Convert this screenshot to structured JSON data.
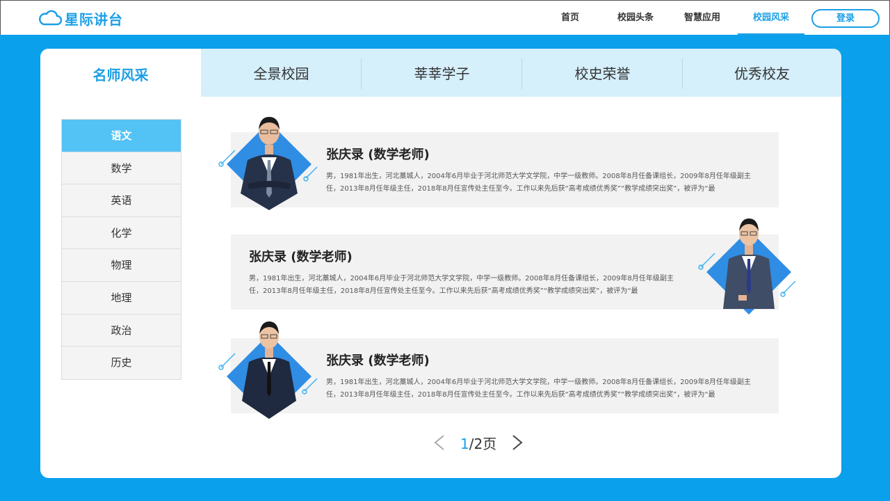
{
  "header": {
    "logo_text": "星际讲台",
    "nav": [
      {
        "label": "首页",
        "active": false
      },
      {
        "label": "校园头条",
        "active": false
      },
      {
        "label": "智慧应用",
        "active": false
      },
      {
        "label": "校园风采",
        "active": true
      }
    ],
    "login_label": "登录"
  },
  "tabs": [
    {
      "label": "名师风采",
      "active": true
    },
    {
      "label": "全景校园",
      "active": false
    },
    {
      "label": "莘莘学子",
      "active": false
    },
    {
      "label": "校史荣誉",
      "active": false
    },
    {
      "label": "优秀校友",
      "active": false
    }
  ],
  "sidebar": {
    "items": [
      {
        "label": "语文",
        "active": true
      },
      {
        "label": "数学",
        "active": false
      },
      {
        "label": "英语",
        "active": false
      },
      {
        "label": "化学",
        "active": false
      },
      {
        "label": "物理",
        "active": false
      },
      {
        "label": "地理",
        "active": false
      },
      {
        "label": "政治",
        "active": false
      },
      {
        "label": "历史",
        "active": false
      }
    ]
  },
  "teachers": [
    {
      "name": "张庆录 (数学老师)",
      "desc": "男，1981年出生，河北藁城人，2004年6月毕业于河北师范大学文学院，中学一级教师。2008年8月任备课组长，2009年8月任年级副主任，2013年8月任年级主任，2018年8月任宣传处主任至今。工作以来先后获“高考成绩优秀奖”“教学成绩突出奖”，被评为“最"
    },
    {
      "name": "张庆录 (数学老师)",
      "desc": "男，1981年出生，河北藁城人，2004年6月毕业于河北师范大学文学院，中学一级教师。2008年8月任备课组长，2009年8月任年级副主任，2013年8月任年级主任，2018年8月任宣传处主任至今。工作以来先后获“高考成绩优秀奖”“教学成绩突出奖”，被评为“最"
    },
    {
      "name": "张庆录 (数学老师)",
      "desc": "男，1981年出生，河北藁城人，2004年6月毕业于河北师范大学文学院，中学一级教师。2008年8月任备课组长，2009年8月任年级副主任，2013年8月任年级主任，2018年8月任宣传处主任至今。工作以来先后获“高考成绩优秀奖”“教学成绩突出奖”，被评为“最"
    }
  ],
  "pager": {
    "current": "1",
    "rest": "/2页"
  },
  "colors": {
    "accent": "#1a9fe6",
    "background": "#0aa0eb",
    "sidebar_active": "#53c2f5",
    "tab_inactive": "#d5effb"
  }
}
